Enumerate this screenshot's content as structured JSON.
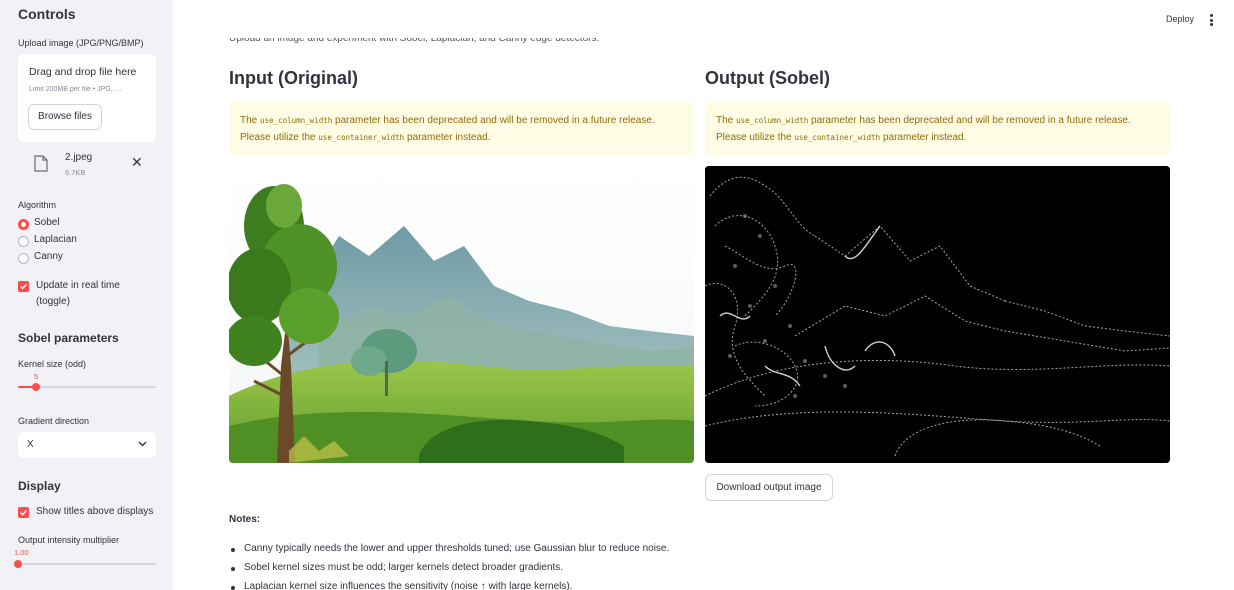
{
  "sidebar": {
    "title": "Controls",
    "upload_label": "Upload image (JPG/PNG/BMP)",
    "dropzone_text": "Drag and drop file here",
    "limit_text": "Limit 200MB per file • JPG, …",
    "browse_label": "Browse files",
    "file": {
      "name": "2.jpeg",
      "size": "6.7KB"
    },
    "algorithm_label": "Algorithm",
    "algorithms": [
      "Sobel",
      "Laplacian",
      "Canny"
    ],
    "selected_algorithm": "Sobel",
    "realtime_label": "Update in real time (toggle)",
    "realtime_checked": true,
    "sobel_section": "Sobel parameters",
    "kernel_label": "Kernel size (odd)",
    "kernel_value": "5",
    "kernel_fraction": 0.13,
    "direction_label": "Gradient direction",
    "direction_value": "X",
    "display_section": "Display",
    "show_titles_label": "Show titles above displays",
    "show_titles_checked": true,
    "intensity_label": "Output intensity multiplier",
    "intensity_value": "1.00",
    "intensity_fraction": 0.0
  },
  "header": {
    "deploy_label": "Deploy",
    "menu_icon": "kebab-menu-icon"
  },
  "main": {
    "intro_text": "Upload an image and experiment with Sobel, Laplacian, and Canny edge detectors.",
    "input_title": "Input (Original)",
    "output_title": "Output (Sobel)",
    "warning": {
      "prefix": "The",
      "code1": "use_column_width",
      "middle": "parameter has been deprecated and will be removed in a future release.",
      "line2_prefix": "Please utilize the",
      "code2": "use_container_width",
      "line2_suffix": "parameter instead."
    },
    "download_label": "Download output image",
    "notes_title": "Notes:",
    "notes": [
      "Canny typically needs the lower and upper thresholds tuned; use Gaussian blur to reduce noise.",
      "Sobel kernel sizes must be odd; larger kernels detect broader gradients.",
      "Laplacian kernel size influences the sensitivity (noise ↑ with large kernels)."
    ]
  },
  "colors": {
    "accent": "#ff4b4b",
    "sidebar_bg": "#f0f2f6",
    "warning_bg": "#fffce6",
    "warning_text": "#926c05"
  }
}
